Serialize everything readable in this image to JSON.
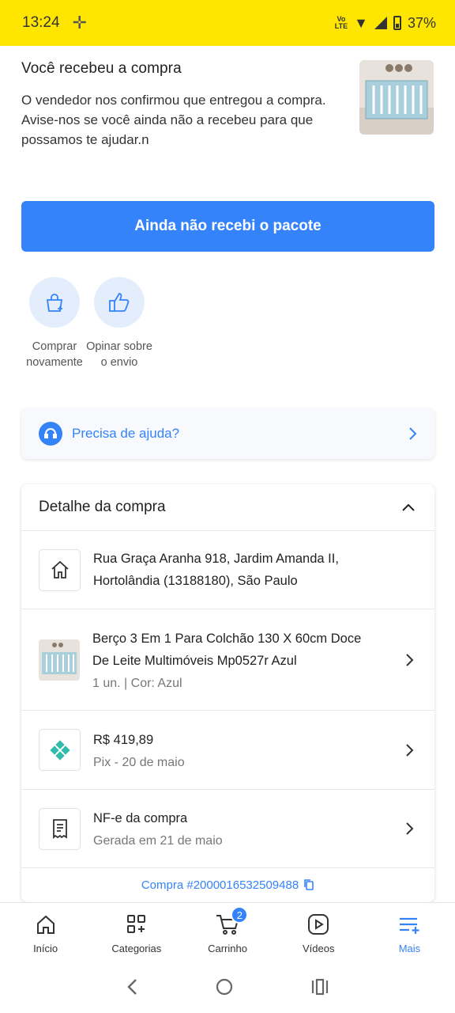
{
  "status_bar": {
    "time": "13:24",
    "network": "LTE",
    "battery": "37%"
  },
  "received": {
    "title": "Você recebeu a compra",
    "body": "O vendedor nos confirmou que entregou a compra. Avise-nos se você ainda não a recebeu para que possamos te ajudar.n"
  },
  "primary_button": "Ainda não recebi o pacote",
  "quick_actions": [
    {
      "label": "Comprar novamente",
      "icon": "shopping-bag-plus-icon"
    },
    {
      "label": "Opinar sobre o envio",
      "icon": "thumbs-up-icon"
    }
  ],
  "help": {
    "label": "Precisa de ajuda?",
    "icon": "headset-icon"
  },
  "detail": {
    "title": "Detalhe da compra",
    "address": "Rua Graça Aranha 918, Jardim Amanda II, Hortolândia (13188180), São Paulo",
    "product": {
      "name": "Berço 3 Em 1 Para Colchão 130 X 60cm Doce De Leite Multimóveis Mp0527r Azul",
      "meta": "1 un. | Cor: Azul"
    },
    "payment": {
      "amount": "R$ 419,89",
      "method": "Pix - 20 de maio",
      "icon": "pix-icon"
    },
    "invoice": {
      "title": "NF-e da compra",
      "sub": "Gerada em 21 de maio",
      "icon": "receipt-icon"
    },
    "order": "Compra #2000016532509488"
  },
  "tabbar": {
    "items": [
      {
        "label": "Início",
        "icon": "home-icon"
      },
      {
        "label": "Categorias",
        "icon": "categories-icon"
      },
      {
        "label": "Carrinho",
        "icon": "cart-icon",
        "badge": "2"
      },
      {
        "label": "Vídeos",
        "icon": "video-icon"
      },
      {
        "label": "Mais",
        "icon": "menu-plus-icon",
        "active": true
      }
    ]
  },
  "colors": {
    "brand_yellow": "#ffe600",
    "primary_blue": "#3483fa",
    "pix_teal": "#32bcad"
  }
}
